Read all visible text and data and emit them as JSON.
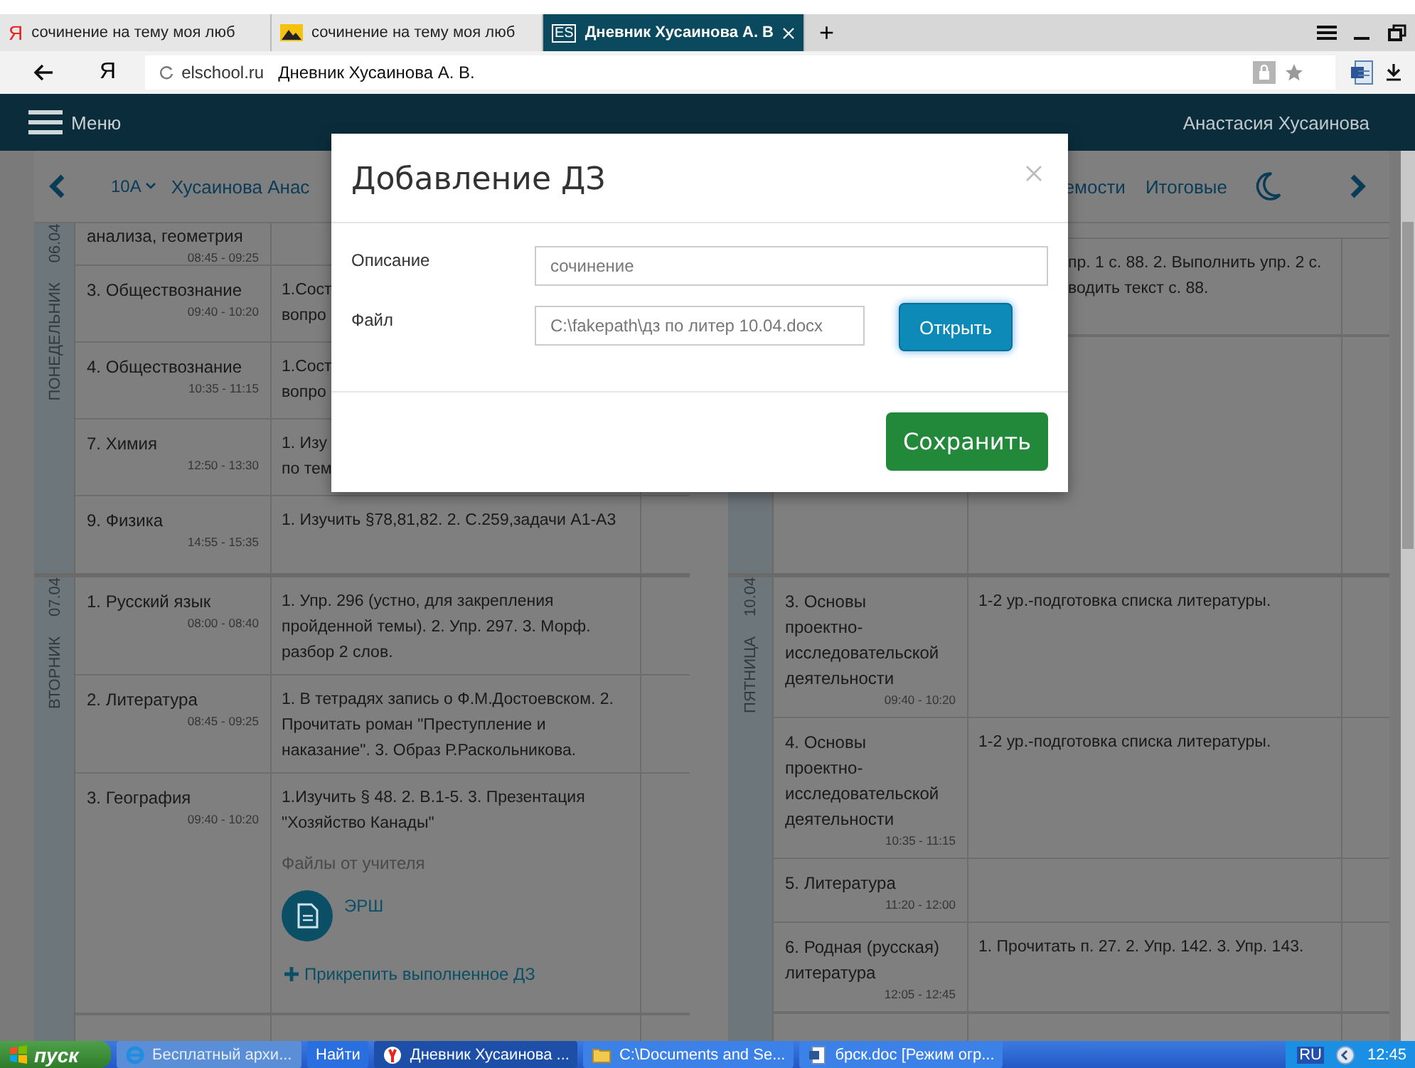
{
  "browser": {
    "tabs": [
      {
        "kind": "letter",
        "logo": "Я",
        "title": "сочинение на тему моя люб",
        "selected": false
      },
      {
        "kind": "image",
        "title": "сочинение на тему моя люб",
        "selected": false
      },
      {
        "kind": "badge",
        "logo": "ES",
        "title": "Дневник Хусаинова А. В",
        "selected": true
      }
    ],
    "new_tab": "+",
    "logo": "Я",
    "domain": "elschool.ru",
    "page_title": "Дневник Хусаинова А. В."
  },
  "app_header": {
    "menu_label": "Меню",
    "user_name": "Анастасия Хусаинова"
  },
  "subnav": {
    "class_name": "10А",
    "student": "Хусаинова Анас",
    "links": [
      "емости",
      "Итоговые"
    ]
  },
  "columns": [
    [
      {
        "weekday": "ПОНЕДЕЛЬНИК",
        "date": "06.04",
        "lessons": [
          {
            "subject": "анализа, геометрия",
            "time": "08:45 - 09:25"
          },
          {
            "subject": "3. Обществознание",
            "time": "09:40 - 10:20",
            "homework": "1.Сост\nвопро"
          },
          {
            "subject": "4. Обществознание",
            "time": "10:35 - 11:15",
            "homework": "1.Сост\nвопро"
          },
          {
            "subject": "7. Химия",
            "time": "12:50 - 13:30",
            "homework": "1. Изу\nпо тем"
          },
          {
            "subject": "9. Физика",
            "time": "14:55 - 15:35",
            "homework": "1. Изучить §78,81,82. 2. С.259,задачи А1-А3"
          }
        ]
      },
      {
        "weekday": "ВТОРНИК",
        "date": "07.04",
        "lessons": [
          {
            "subject": "1. Русский язык",
            "time": "08:00 - 08:40",
            "homework": "1. Упр. 296 (устно, для закрепления пройденной темы). 2. Упр. 297. 3. Морф. разбор 2 слов."
          },
          {
            "subject": "2. Литература",
            "time": "08:45 - 09:25",
            "homework": "1. В тетрадях запись о Ф.М.Достоевском. 2. Прочитать роман \"Преступление и наказание\". 3. Образ Р.Раскольникова."
          },
          {
            "subject": "3. География",
            "time": "09:40 - 10:20",
            "homework": "1.Изучить § 48. 2. В.1-5. 3. Презентация \"Хозяйство Канады\"",
            "files_label": "Файлы от учителя",
            "files": [
              "ЭРШ"
            ],
            "attach_link": "Прикрепить выполненное ДЗ"
          }
        ]
      }
    ],
    [
      {
        "lessons": [
          {
            "homework": "пр. 1 с. 88. 2. Выполнить упр. 2 с.\nводить текст с. 88.",
            "clipped_left": true
          }
        ]
      },
      {
        "weekday": "ПЯТНИЦА",
        "date": "10.04",
        "lessons": [
          {
            "subject": "3. Основы проектно-исследовательской деятельности",
            "time": "09:40 - 10:20",
            "homework": "1-2 ур.-подготовка списка литературы."
          },
          {
            "subject": "4. Основы проектно-исследовательской деятельности",
            "time": "10:35 - 11:15",
            "homework": "1-2 ур.-подготовка списка литературы."
          },
          {
            "subject": "5. Литература",
            "time": "11:20 - 12:00"
          },
          {
            "subject": "6. Родная (русская) литература",
            "time": "12:05 - 12:45",
            "homework": "1. Прочитать п. 27. 2. Упр. 142. 3. Упр. 143."
          }
        ]
      }
    ]
  ],
  "modal": {
    "title": "Добавление ДЗ",
    "fields": [
      {
        "kind": "text",
        "label": "Описание",
        "value": "сочинение"
      },
      {
        "kind": "file",
        "label": "Файл",
        "value": "C:\\fakepath\\дз по литер 10.04.docx",
        "button": "Открыть"
      }
    ],
    "save_button": "Сохранить"
  },
  "taskbar": {
    "start": "пуск",
    "items": [
      {
        "kind": "ie",
        "label": "Бесплатный архи...",
        "selected": false
      },
      {
        "kind": "search",
        "label": "Найти",
        "selected": false
      },
      {
        "kind": "yandex",
        "label": "Дневник Хусаинова ...",
        "selected": true
      },
      {
        "kind": "folder",
        "label": "C:\\Documents and Se...",
        "selected": false
      },
      {
        "kind": "word",
        "label": "брск.doc [Режим огр...",
        "selected": false
      }
    ],
    "language": "RU",
    "clock": "12:45"
  }
}
